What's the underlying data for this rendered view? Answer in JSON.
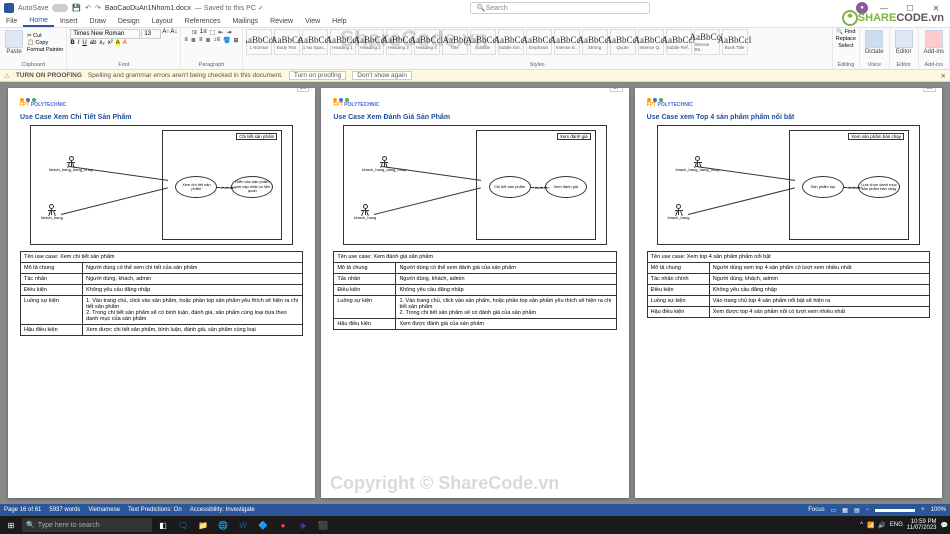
{
  "titlebar": {
    "autosave": "AutoSave",
    "doc": "BaoCaoDuAn1Nhom1.docx",
    "saved": "— Saved to this PC ✓",
    "searchPlaceholder": "Search"
  },
  "tabs": [
    "File",
    "Home",
    "Insert",
    "Draw",
    "Design",
    "Layout",
    "References",
    "Mailings",
    "Review",
    "View",
    "Help"
  ],
  "activeTab": 1,
  "ribbon": {
    "clipboard": {
      "paste": "Paste",
      "formatPainter": "Format Painter",
      "label": "Clipboard"
    },
    "font": {
      "name": "Times New Roman",
      "size": "13",
      "label": "Font"
    },
    "paragraph": {
      "label": "Paragraph"
    },
    "styles": {
      "label": "Styles",
      "items": [
        {
          "prev": "AaBbCcI",
          "nm": "1 Normal"
        },
        {
          "prev": "AaBbCc",
          "nm": "Body Text"
        },
        {
          "prev": "AaBbCcI",
          "nm": "1 No Spac.."
        },
        {
          "prev": "AaBbCcI",
          "nm": "Heading 1"
        },
        {
          "prev": "AaBbCcI",
          "nm": "Heading 2"
        },
        {
          "prev": "AaBbCcI",
          "nm": "Heading 3"
        },
        {
          "prev": "AaBbCcI",
          "nm": "Heading 4"
        },
        {
          "prev": "AaBb(",
          "nm": "Title"
        },
        {
          "prev": "AaBbCcI",
          "nm": "Subtitle"
        },
        {
          "prev": "AaBbCcI",
          "nm": "Subtle Em.."
        },
        {
          "prev": "AaBbCcI",
          "nm": "Emphasis"
        },
        {
          "prev": "AaBbCcI",
          "nm": "Intense E.."
        },
        {
          "prev": "AaBbCcI",
          "nm": "Strong"
        },
        {
          "prev": "AaBbCcI",
          "nm": "Quote"
        },
        {
          "prev": "AaBbCcI",
          "nm": "Intense Q.."
        },
        {
          "prev": "AaBbCcI",
          "nm": "Subtle Ref.."
        },
        {
          "prev": "AaBbCcI",
          "nm": "Intense Re.."
        },
        {
          "prev": "AaBbCcI",
          "nm": "Book Title"
        }
      ]
    },
    "editing": {
      "find": "Find",
      "replace": "Replace",
      "select": "Select",
      "label": "Editing"
    },
    "voice": {
      "dictate": "Dictate",
      "label": "Voice"
    },
    "editor": {
      "editor": "Editor",
      "label": "Editor"
    },
    "addins": {
      "addins": "Add-ins",
      "label": "Add-ins"
    }
  },
  "msgbar": {
    "turnon": "TURN ON PROOFING",
    "text": "Spelling and grammar errors aren't being checked in this document.",
    "btn1": "Turn on proofing",
    "btn2": "Don't show again"
  },
  "pages": {
    "p16": {
      "num": "16",
      "poly": "FPT POLYTECHNIC",
      "title": "Use Case Xem Chi Tiết Sản Phẩm",
      "sys": "Chi tiết sản phẩm",
      "actor1": "khach_hang_dang_nhap",
      "actor2": "khach_hang",
      "uc1": "Xem chi tiết sản phẩm",
      "uc2": "Hiển các sản phẩm mới cập nhật có liên quan",
      "rel": "«include»",
      "tbl": [
        [
          "Tên use case: Xem chi tiết sản phẩm",
          ""
        ],
        [
          "Mô tả chung",
          "Người dùng có thể xem chi tiết của sản phẩm"
        ],
        [
          "Tác nhân",
          "Người dùng, khách, admin"
        ],
        [
          "Điều kiện",
          "Không yêu cầu đăng nhập"
        ],
        [
          "Luồng sự kiện",
          "1. Vào trang chủ, click vào sản phẩm, hoặc phần top sản phẩm yêu thích sẽ hiện ra chi tiết sản phẩm\n2. Trong chi tiết sản phẩm sẽ có bình luận, đánh giá, sản phẩm cùng loại dựa theo danh mục của sản phẩm"
        ],
        [
          "Hậu điều kiện",
          "Xem được chi tiết sản phẩm, bình luận, đánh giá, sản phẩm cùng loại"
        ]
      ]
    },
    "p17": {
      "num": "17",
      "poly": "FPT POLYTECHNIC",
      "title": "Use Case Xem Đánh Giá Sản Phẩm",
      "sys": "Xem đánh giá",
      "actor1": "khach_hang_dang_nhap",
      "actor2": "khach_hang",
      "uc1": "Chi tiết sản phẩm",
      "uc2": "Xem đánh giá",
      "rel": "«include»",
      "tbl": [
        [
          "Tên use case: Xem đánh giá sản phẩm",
          ""
        ],
        [
          "Mô tả chung",
          "Người dùng có thể xem đánh giá của sản phẩm"
        ],
        [
          "Tác nhân",
          "Người dùng, khách, admin"
        ],
        [
          "Điều kiện",
          "Không yêu cầu đăng nhập"
        ],
        [
          "Luồng sự kiện",
          "1. Vào trang chủ, click vào sản phẩm, hoặc phần top sản phẩm yêu thích sẽ hiện ra chi tiết sản phẩm\n2. Trong chi tiết sản phẩm sẽ có đánh giá của sản phẩm"
        ],
        [
          "Hậu điều kiện",
          "Xem được đánh giá của sản phẩm"
        ]
      ]
    },
    "p18": {
      "num": "18",
      "poly": "FPT POLYTECHNIC",
      "title": "Use Case xem Top 4 sản phẩm phẩm nổi bật",
      "sys": "Xem sản phẩm bán chạy",
      "actor1": "khach_hang_dang_nhap",
      "actor2": "khach_hang",
      "uc1": "Sản phẩm top",
      "uc2": "Lựa chọn danh mục sản phẩm bán chạy",
      "rel": "«include»",
      "tbl": [
        [
          "Tên use case: Xem top 4 sản phẩm phẩm nổi bật",
          ""
        ],
        [
          "Mô tả chung",
          "Người dùng xem top 4 sản phẩm có lượt xem nhiều nhất"
        ],
        [
          "Tác nhân chính",
          "Người dùng, khách, admin"
        ],
        [
          "Điều kiện",
          "Không yêu cầu đăng nhập"
        ],
        [
          "Luồng sự kiện",
          "Vào trang chủ top 4 sản phẩm nổi bật sẽ hiện ra"
        ],
        [
          "Hậu điều kiện",
          "Xem được top 4 sản phẩm nổi có lượt xem nhiều nhất"
        ]
      ]
    }
  },
  "statusbar": {
    "page": "Page 16 of 61",
    "words": "5937 words",
    "lang": "Vietnamese",
    "pred": "Text Predictions: On",
    "acc": "Accessibility: Investigate",
    "focus": "Focus",
    "zoom": "100%"
  },
  "taskbar": {
    "search": "Type here to search",
    "time": "10:59 PM",
    "date": "11/07/2023"
  },
  "watermarks": {
    "top": "ShareCode.vn",
    "bottom": "Copyright © ShareCode.vn",
    "brand1": "SHARE",
    "brand2": "CODE.vn"
  }
}
